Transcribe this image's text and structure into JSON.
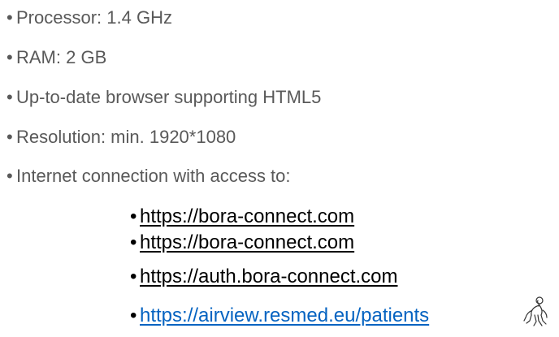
{
  "requirements": [
    {
      "bullet": "•",
      "text": "Processor: 1.4 GHz"
    },
    {
      "bullet": "•",
      "text": "RAM: 2 GB"
    },
    {
      "bullet": "•",
      "text": "Up-to-date browser supporting HTML5"
    },
    {
      "bullet": "•",
      "text": "Resolution: min. 1920*1080"
    },
    {
      "bullet": "•",
      "text": "Internet connection with access to:"
    }
  ],
  "links": [
    {
      "bullet": "•",
      "text": "https://bora-connect.com"
    },
    {
      "bullet": "•",
      "text": "https://bora-connect.com"
    },
    {
      "bullet": "•",
      "text": "https://auth.bora-connect.com"
    },
    {
      "bullet": "•",
      "text": "https://airview.resmed.eu/patients"
    }
  ],
  "colors": {
    "text_gray": "#595959",
    "link_black": "#000000",
    "link_blue": "#0563c1"
  },
  "icons": {
    "person": "person-walking-icon"
  }
}
